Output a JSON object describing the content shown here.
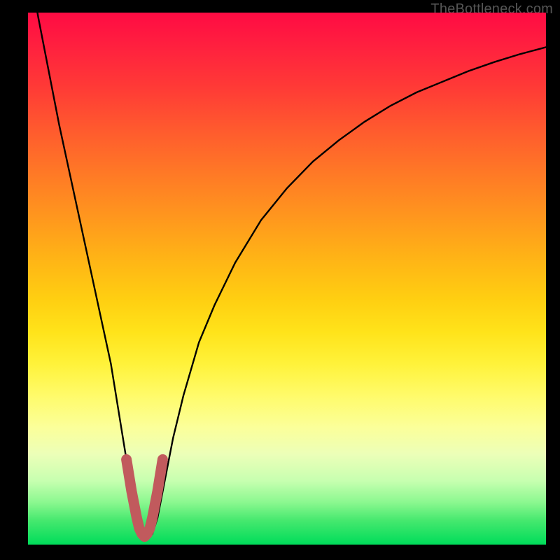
{
  "watermark": {
    "text": "TheBottleneck.com"
  },
  "colors": {
    "page_bg": "#000000",
    "curve": "#000000",
    "marker_stroke": "#c15a5d",
    "gradient_top": "#ff0b43",
    "gradient_bottom": "#00dc5a"
  },
  "chart_data": {
    "type": "line",
    "title": "",
    "xlabel": "",
    "ylabel": "",
    "xlim": [
      0,
      100
    ],
    "ylim": [
      0,
      100
    ],
    "grid": false,
    "legend": false,
    "series": [
      {
        "name": "bottleneck-curve",
        "x": [
          0,
          2,
          4,
          6,
          8,
          10,
          12,
          14,
          16,
          18,
          19,
          20,
          21,
          22,
          23,
          24,
          25,
          26,
          28,
          30,
          33,
          36,
          40,
          45,
          50,
          55,
          60,
          65,
          70,
          75,
          80,
          85,
          90,
          95,
          100
        ],
        "values": [
          110,
          99,
          89,
          79,
          70,
          61,
          52,
          43,
          34,
          22,
          16,
          10,
          5,
          2,
          1,
          2,
          5,
          10,
          20,
          28,
          38,
          45,
          53,
          61,
          67,
          72,
          76,
          79.5,
          82.5,
          85,
          87,
          89,
          90.7,
          92.2,
          93.5
        ]
      }
    ],
    "markers": {
      "name": "highlighted-minimum",
      "x": [
        19,
        20,
        21,
        21.5,
        22,
        22.5,
        23,
        23.5,
        24,
        25,
        26
      ],
      "values": [
        16,
        10,
        5,
        3,
        2,
        1.5,
        2,
        3,
        5,
        10,
        16
      ]
    },
    "minimum_x": 22.5
  }
}
